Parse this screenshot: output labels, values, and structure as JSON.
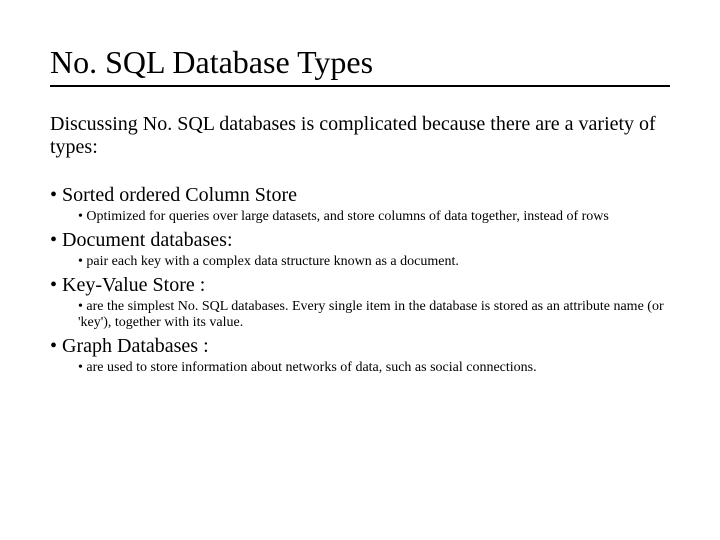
{
  "title": "No. SQL Database Types",
  "intro": "Discussing No. SQL databases is complicated because there are a variety of types:",
  "items": [
    {
      "heading": "Sorted ordered Column Store",
      "sub": "Optimized for queries over large datasets, and store columns of data together, instead of rows"
    },
    {
      "heading": "Document databases:",
      "sub": "pair each key with a complex data structure known as a document."
    },
    {
      "heading": "Key-Value Store :",
      "sub": "are the simplest No. SQL databases. Every single item in the database is stored as an attribute name (or 'key'), together with its value."
    },
    {
      "heading": "Graph Databases :",
      "sub": "are used to store information about networks of data, such as social connections."
    }
  ]
}
